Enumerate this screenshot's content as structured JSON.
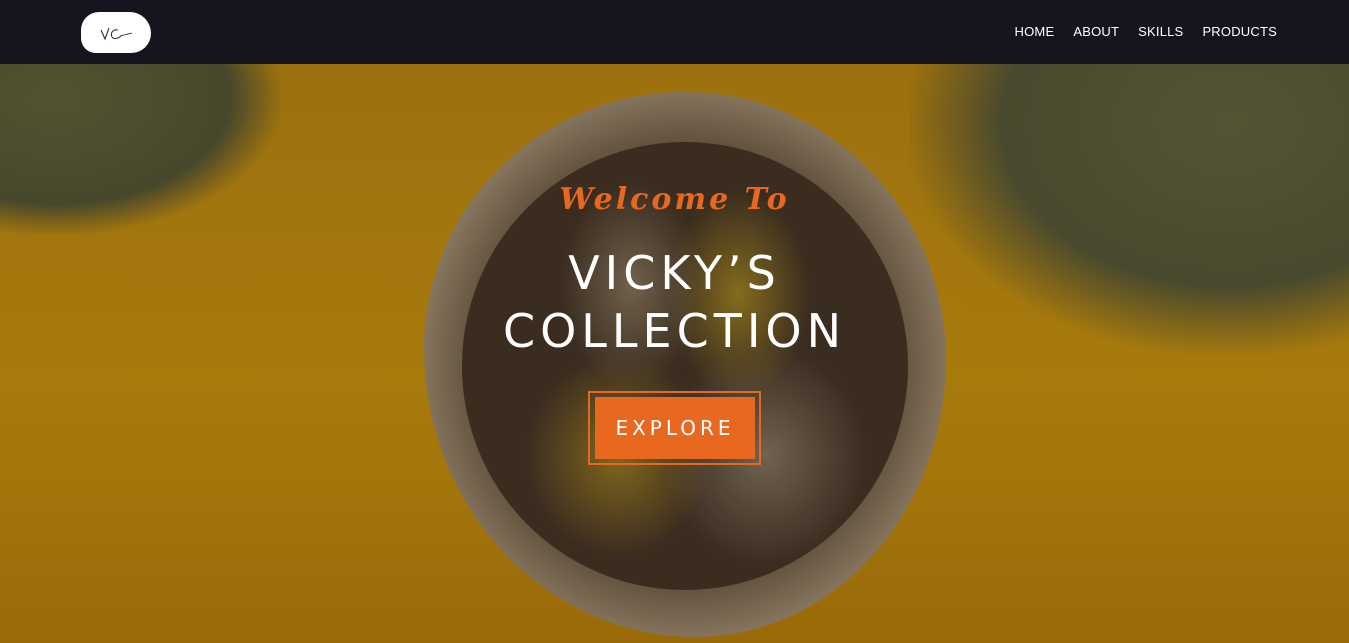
{
  "logo": {
    "initials": "VC"
  },
  "nav": {
    "items": [
      {
        "label": "HOME"
      },
      {
        "label": "ABOUT"
      },
      {
        "label": "SKILLS"
      },
      {
        "label": "PRODUCTS"
      }
    ]
  },
  "hero": {
    "welcome": "Welcome To",
    "title_line1": "VICKY’S",
    "title_line2": "COLLECTION",
    "cta_label": "EXPLORE"
  },
  "colors": {
    "navbar_bg": "#16151f",
    "accent": "#e8681f",
    "hero_bg": "#b7860f",
    "text_light": "#ffffff"
  }
}
